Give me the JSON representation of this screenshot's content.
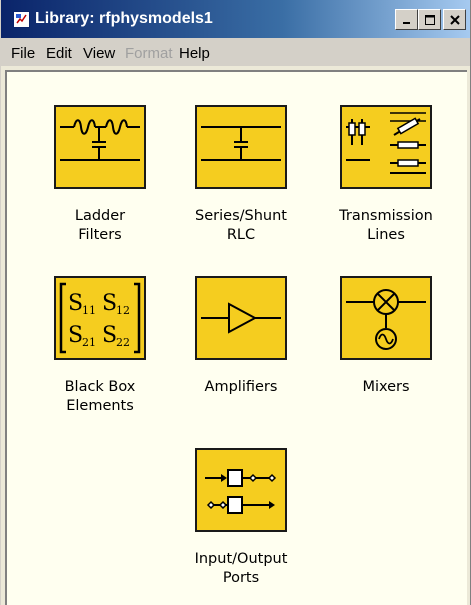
{
  "window": {
    "title": "Library: rfphysmodels1",
    "minimize_glyph": "_",
    "maximize_glyph": "□",
    "close_glyph": "✕"
  },
  "menu": {
    "file": "File",
    "edit": "Edit",
    "view": "View",
    "format": "Format",
    "help": "Help"
  },
  "blocks": {
    "ladder_filters": {
      "label": "Ladder\nFilters",
      "icon": "ladder-filter-icon"
    },
    "series_shunt_rlc": {
      "label": "Series/Shunt\nRLC",
      "icon": "series-shunt-rlc-icon"
    },
    "transmission_lines": {
      "label": "Transmission\nLines",
      "icon": "transmission-lines-icon"
    },
    "black_box": {
      "label": "Black Box\nElements",
      "icon": "s-parameter-matrix-icon"
    },
    "amplifiers": {
      "label": "Amplifiers",
      "icon": "amplifier-triangle-icon"
    },
    "mixers": {
      "label": "Mixers",
      "icon": "mixer-icon"
    },
    "io_ports": {
      "label": "Input/Output\nPorts",
      "icon": "io-ports-icon"
    }
  },
  "colors": {
    "block_fill": "#f5cd1f",
    "block_border": "#1a1a1a",
    "canvas_bg": "#fffff0",
    "menubar_bg": "#d4d0c8",
    "titlebar_dark": "#0a246a"
  }
}
